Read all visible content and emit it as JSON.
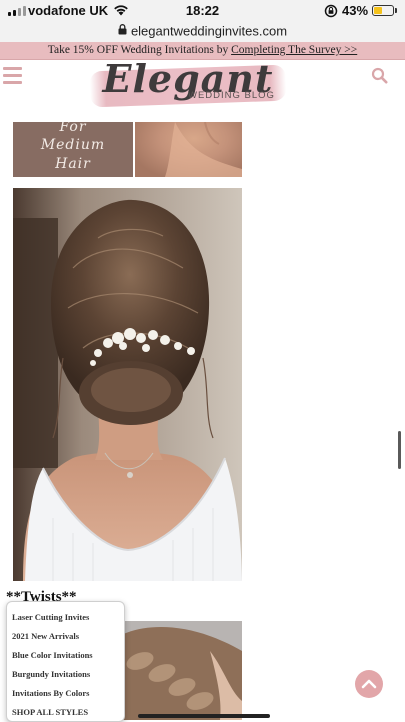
{
  "status_bar": {
    "carrier": "vodafone UK",
    "time": "18:22",
    "battery_percent": "43%",
    "battery_level": 0.43,
    "icons": [
      "signal-icon",
      "wifi-icon",
      "rotation-lock-icon",
      "battery-icon"
    ]
  },
  "browser": {
    "url": "elegantweddinginvites.com",
    "icons": [
      "lock-icon"
    ]
  },
  "promo": {
    "text": "Take 15% OFF Wedding Invitations by ",
    "link": "Completing The Survey >>"
  },
  "header": {
    "logo_script": "Elegant",
    "logo_sub": "WEDDING BLOG",
    "icons": [
      "hamburger-menu-icon",
      "search-icon"
    ]
  },
  "content": {
    "tile_text": [
      "For",
      "Medium",
      "Hair"
    ],
    "section_heading": "**Twists**"
  },
  "float_menu": {
    "items": [
      "Laser Cutting Invites",
      "2021 New Arrivals",
      "Blue Color Invitations",
      "Burgundy Invitations",
      "Invitations By Colors",
      "SHOP ALL STYLES"
    ]
  },
  "scroll": {
    "icons": [
      "back-to-top-icon"
    ]
  },
  "colors": {
    "promo_bg": "#e8bcbf",
    "accent_pink": "#d9a6a9",
    "tile_brown": "#876c62"
  }
}
